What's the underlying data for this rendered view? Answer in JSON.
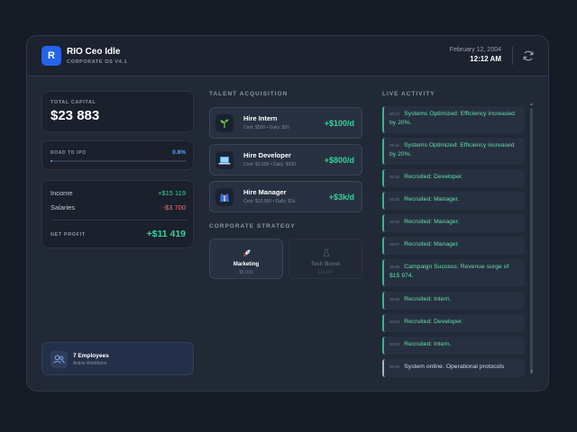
{
  "header": {
    "logo_letter": "R",
    "title": "RIO Ceo Idle",
    "subtitle": "CORPORATE OS V4.1",
    "date": "February 12, 2004",
    "time": "12:12 AM",
    "refresh_icon": "refresh-icon"
  },
  "capital": {
    "label": "TOTAL CAPITAL",
    "value": "$23 883"
  },
  "ipo": {
    "label": "ROAD TO IPO",
    "percent_text": "0.8%",
    "progress": 0.008
  },
  "finance": {
    "income_label": "Income",
    "income_value": "+$15 119",
    "salaries_label": "Salaries",
    "salaries_value": "-$3 700",
    "net_label": "NET PROFIT",
    "net_value": "+$11 419"
  },
  "employees": {
    "count_text": "7 Employees",
    "sub": "Active Workforce",
    "icon": "users-icon"
  },
  "talent": {
    "title": "TALENT ACQUISITION",
    "items": [
      {
        "title": "Hire Intern",
        "sub": "Cost: $500 • Daily: $50",
        "value": "+$100/d",
        "icon": "sprout-icon"
      },
      {
        "title": "Hire Developer",
        "sub": "Cost: $2,000 • Daily: $300",
        "value": "+$800/d",
        "icon": "laptop-icon"
      },
      {
        "title": "Hire Manager",
        "sub": "Cost: $10,000 • Daily: $1k",
        "value": "+$3k/d",
        "icon": "suit-icon"
      }
    ]
  },
  "strategy": {
    "title": "CORPORATE STRATEGY",
    "items": [
      {
        "name": "Marketing",
        "cost": "$5,000",
        "icon": "rocket-icon",
        "enabled": true
      },
      {
        "name": "Tech Boost",
        "cost": "$15,000",
        "icon": "flask-icon",
        "enabled": false
      }
    ]
  },
  "activity": {
    "title": "LIVE ACTIVITY",
    "items": [
      {
        "ts": "00:12",
        "text": "Systems Optimized: Efficiency increased by 20%."
      },
      {
        "ts": "00:11",
        "text": "Systems Optimized: Efficiency increased by 20%."
      },
      {
        "ts": "00:10",
        "text": "Recruited: Developer."
      },
      {
        "ts": "00:09",
        "text": "Recruited: Manager."
      },
      {
        "ts": "00:08",
        "text": "Recruited: Manager."
      },
      {
        "ts": "00:07",
        "text": "Recruited: Manager."
      },
      {
        "ts": "00:06",
        "text": "Campaign Success: Revenue surge of $15 974."
      },
      {
        "ts": "00:05",
        "text": "Recruited: Intern."
      },
      {
        "ts": "00:04",
        "text": "Recruited: Developer."
      },
      {
        "ts": "00:03",
        "text": "Recruited: Intern."
      },
      {
        "ts": "00:00",
        "text": "System online. Operational protocols"
      }
    ]
  },
  "colors": {
    "accent": "#2563eb",
    "positive": "#34d399",
    "negative": "#f87171",
    "progress": "#60a5fa"
  }
}
